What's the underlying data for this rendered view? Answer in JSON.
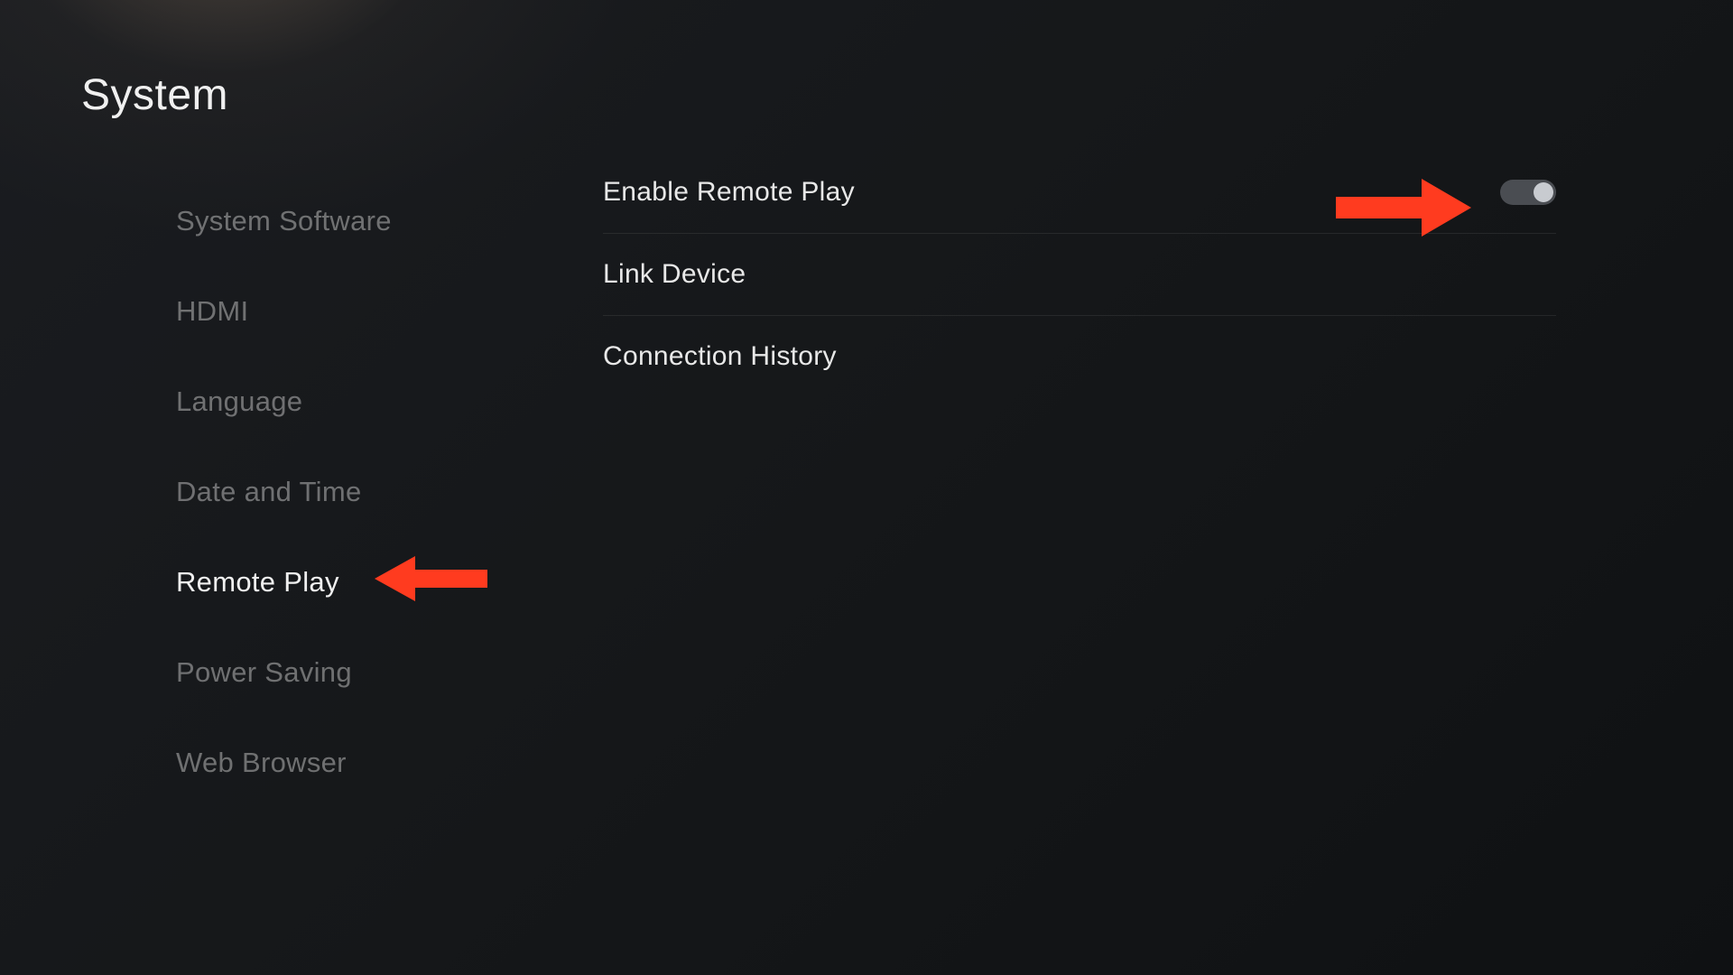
{
  "header": {
    "title": "System"
  },
  "sidebar": {
    "items": [
      {
        "label": "System Software",
        "active": false
      },
      {
        "label": "HDMI",
        "active": false
      },
      {
        "label": "Language",
        "active": false
      },
      {
        "label": "Date and Time",
        "active": false
      },
      {
        "label": "Remote Play",
        "active": true
      },
      {
        "label": "Power Saving",
        "active": false
      },
      {
        "label": "Web Browser",
        "active": false
      }
    ]
  },
  "main": {
    "settings": [
      {
        "label": "Enable Remote Play",
        "type": "toggle",
        "value": "on"
      },
      {
        "label": "Link Device",
        "type": "link"
      },
      {
        "label": "Connection History",
        "type": "link"
      }
    ]
  },
  "annotations": {
    "arrow_color": "#ff3b1f"
  }
}
